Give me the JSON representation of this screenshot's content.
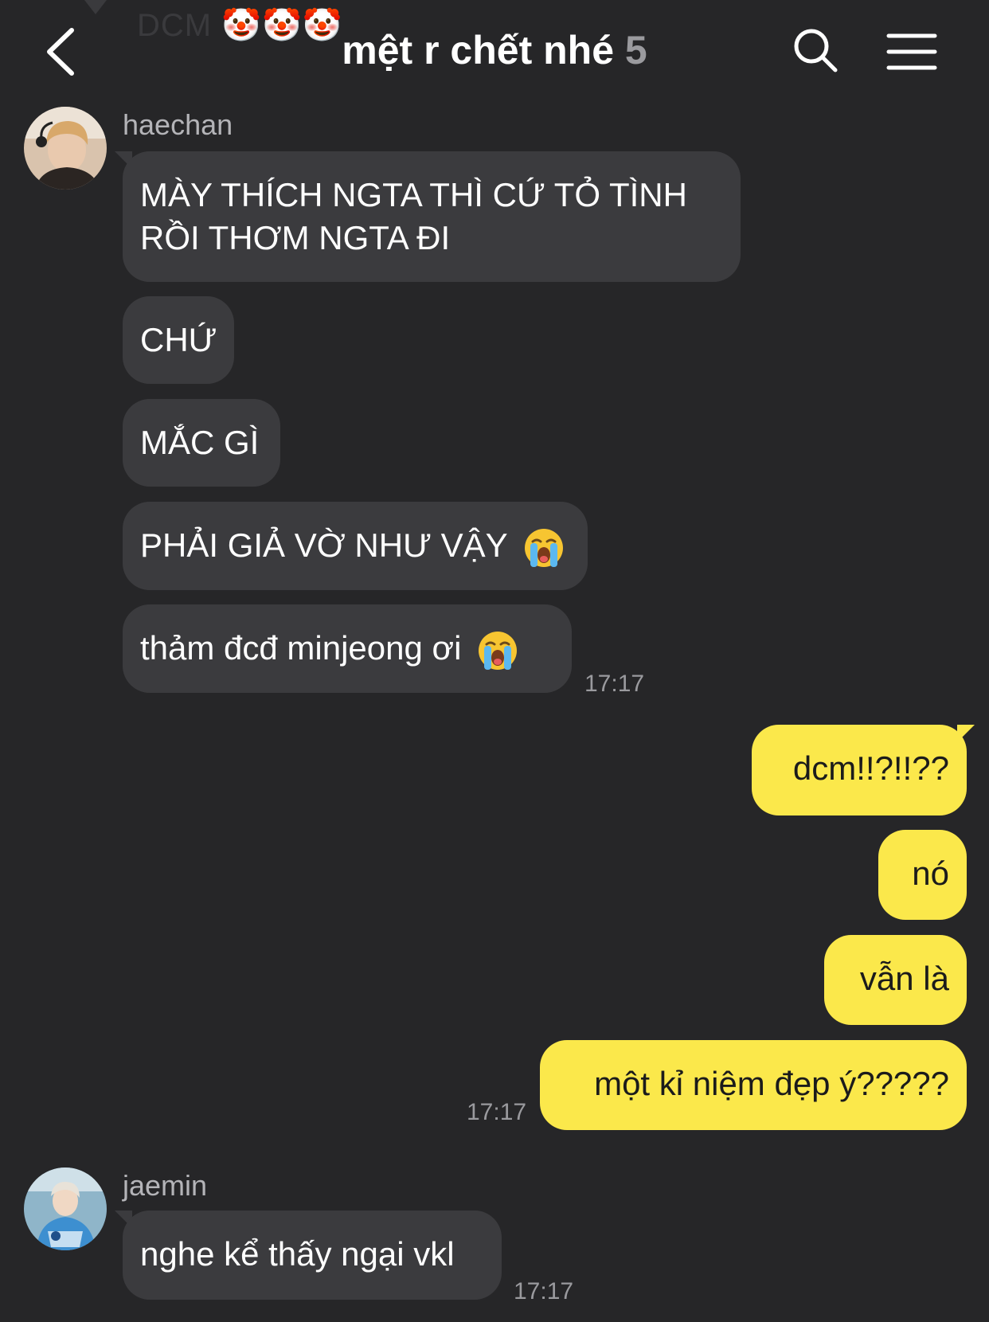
{
  "background_preview": {
    "text": "DCM",
    "emoji": "🤡🤡🤡"
  },
  "header": {
    "title": "mệt r chết nhé",
    "member_count": "5",
    "back_icon": "chevron-left-icon",
    "search_icon": "search-icon",
    "menu_icon": "hamburger-menu-icon"
  },
  "messages": {
    "haechan": {
      "sender": "haechan",
      "bubbles": [
        "MÀY THÍCH NGTA THÌ CỨ TỎ TÌNH RỒI THƠM NGTA ĐI",
        "CHỨ",
        "MẮC GÌ",
        "PHẢI GIẢ VỜ NHƯ VẬY",
        "thảm đcđ minjeong ơi"
      ],
      "time": "17:17"
    },
    "me": {
      "bubbles": [
        "dcm!!?!!??",
        "nó",
        "vẫn là",
        "một kỉ niệm đẹp ý?????"
      ],
      "time": "17:17"
    },
    "jaemin": {
      "sender": "jaemin",
      "bubbles": [
        "nghe kể thấy ngại vkl"
      ],
      "time": "17:17"
    }
  },
  "colors": {
    "background": "#262628",
    "incoming_bubble": "#3b3b3e",
    "outgoing_bubble": "#fbe84b",
    "timestamp": "#9a9a9e"
  }
}
